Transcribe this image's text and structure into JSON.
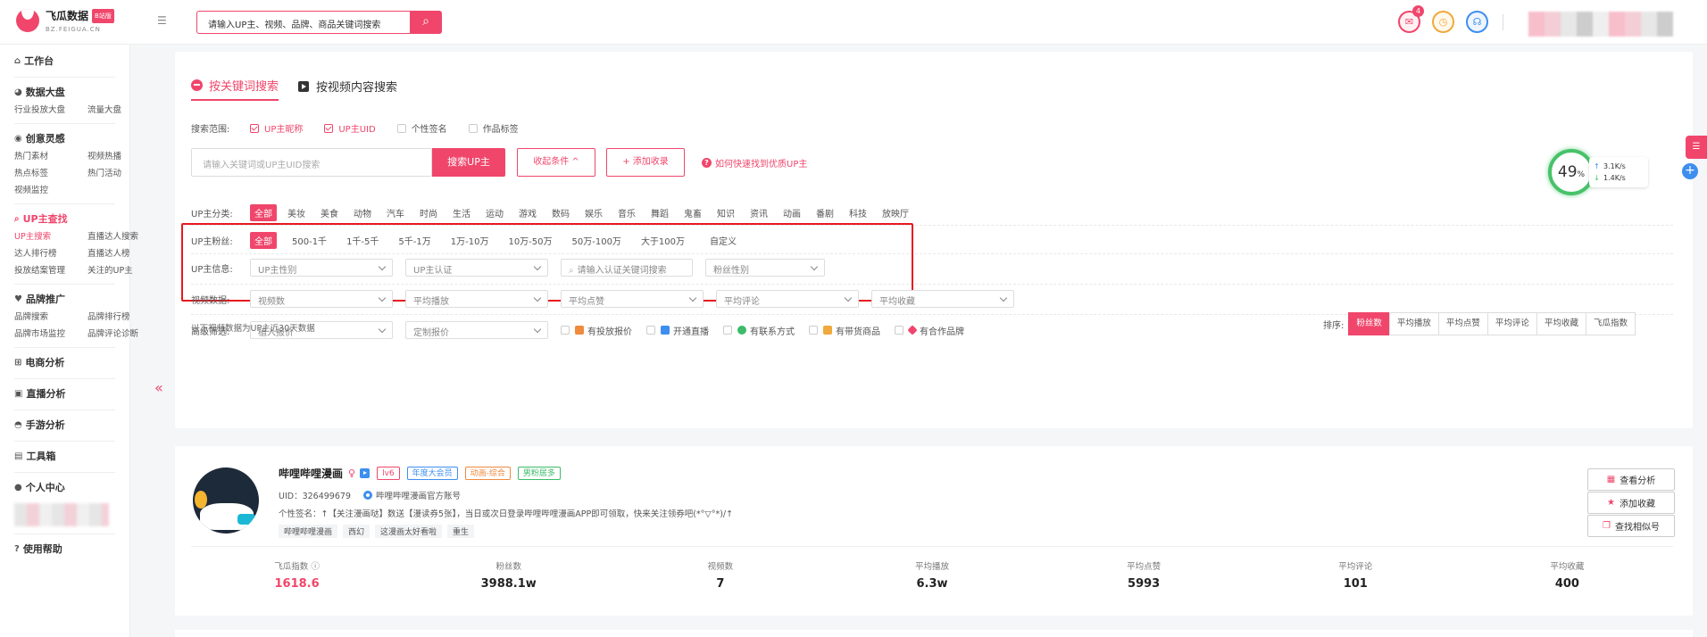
{
  "header": {
    "logo_name": "飞瓜数据",
    "logo_badge": "B站版",
    "logo_sub": "BZ.FEIGUA.CN",
    "search_value": "请输入UP主、视频、品牌、商品关键词搜索",
    "mail_count": "4"
  },
  "sidebar": {
    "workbench": "工作台",
    "dashboard": {
      "title": "数据大盘",
      "items": [
        "行业投放大盘",
        "流量大盘"
      ]
    },
    "creative": {
      "title": "创意灵感",
      "items": [
        "热门素材",
        "视频热播",
        "热点标签",
        "热门活动",
        "视频监控"
      ]
    },
    "up_search": {
      "title": "UP主查找",
      "items": [
        "UP主搜索",
        "直播达人搜索",
        "达人排行榜",
        "直播达人榜",
        "投放结案管理",
        "关注的UP主"
      ]
    },
    "brand": {
      "title": "品牌推广",
      "items": [
        "品牌搜索",
        "品牌排行榜",
        "品牌市场监控",
        "品牌评论诊断"
      ]
    },
    "ecommerce": "电商分析",
    "live": "直播分析",
    "game": "手游分析",
    "toolbox": "工具箱",
    "personal": "个人中心",
    "help": "使用帮助"
  },
  "filter": {
    "tabs": [
      "按关键词搜索",
      "按视频内容搜索"
    ],
    "scope_label": "搜索范围:",
    "scope_options": [
      {
        "label": "UP主昵称",
        "checked": true
      },
      {
        "label": "UP主UID",
        "checked": true
      },
      {
        "label": "个性签名",
        "checked": false
      },
      {
        "label": "作品标签",
        "checked": false
      }
    ],
    "keyword_placeholder": "请输入关键词或UP主UID搜索",
    "search_btn": "搜索UP主",
    "collapse_btn": "收起条件 ^",
    "add_btn": "+ 添加收录",
    "help_text": "如何快速找到优质UP主",
    "category_label": "UP主分类:",
    "categories": [
      "全部",
      "美妆",
      "美食",
      "动物",
      "汽车",
      "时尚",
      "生活",
      "运动",
      "游戏",
      "数码",
      "娱乐",
      "音乐",
      "舞蹈",
      "鬼畜",
      "知识",
      "资讯",
      "动画",
      "番剧",
      "科技",
      "放映厅"
    ],
    "fans_label": "UP主粉丝:",
    "fans_ranges": [
      "全部",
      "500-1千",
      "1千-5千",
      "5千-1万",
      "1万-10万",
      "10万-50万",
      "50万-100万",
      "大于100万",
      "自定义"
    ],
    "info_label": "UP主信息:",
    "info_selects": [
      "UP主性别",
      "UP主认证",
      "请输入认证关键词搜索",
      "粉丝性别"
    ],
    "video_label": "视频数据:",
    "video_selects": [
      "视频数",
      "平均播放",
      "平均点赞",
      "平均评论",
      "平均收藏"
    ],
    "advanced_label": "高级筛选:",
    "advanced_selects": [
      "植入报价",
      "定制报价"
    ],
    "advanced_features": [
      "有投放报价",
      "开通直播",
      "有联系方式",
      "有带货商品",
      "有合作品牌"
    ],
    "note": "以下视频数据为UP主近30天数据",
    "sort_label": "排序:",
    "sort_options": [
      "粉丝数",
      "平均播放",
      "平均点赞",
      "平均评论",
      "平均收藏",
      "飞瓜指数"
    ]
  },
  "speed_widget": {
    "percent": "49",
    "unit": "%",
    "up": "3.1K/s",
    "down": "1.4K/s"
  },
  "result": {
    "name": "哔哩哔哩漫画",
    "gender_icon": "♀",
    "tags": [
      {
        "text": "lv6",
        "color": "#f0466b"
      },
      {
        "text": "年度大会员",
        "color": "#3d8ef0"
      },
      {
        "text": "动画-综合",
        "color": "#f08a3c"
      },
      {
        "text": "男粉居多",
        "color": "#3dbb6a"
      }
    ],
    "uid": "UID：326499679",
    "verify": "哔哩哔哩漫画官方账号",
    "signature": "个性签名：↑【关注漫画哒】数送【漫读券5张】，当日或次日登录哔哩哔哩漫画APP即可领取，快来关注领券吧(*°▽°*)/↑",
    "keywords": [
      "哔哩哔哩漫画",
      "西幻",
      "这漫画太好看啦",
      "重生"
    ],
    "actions": [
      "查看分析",
      "添加收藏",
      "查找相似号"
    ],
    "metrics": [
      {
        "label": "飞瓜指数 ⓘ",
        "value": "1618.6"
      },
      {
        "label": "粉丝数",
        "value": "3988.1w"
      },
      {
        "label": "视频数",
        "value": "7"
      },
      {
        "label": "平均播放",
        "value": "6.3w"
      },
      {
        "label": "平均点赞",
        "value": "5993"
      },
      {
        "label": "平均评论",
        "value": "101"
      },
      {
        "label": "平均收藏",
        "value": "400"
      }
    ]
  }
}
